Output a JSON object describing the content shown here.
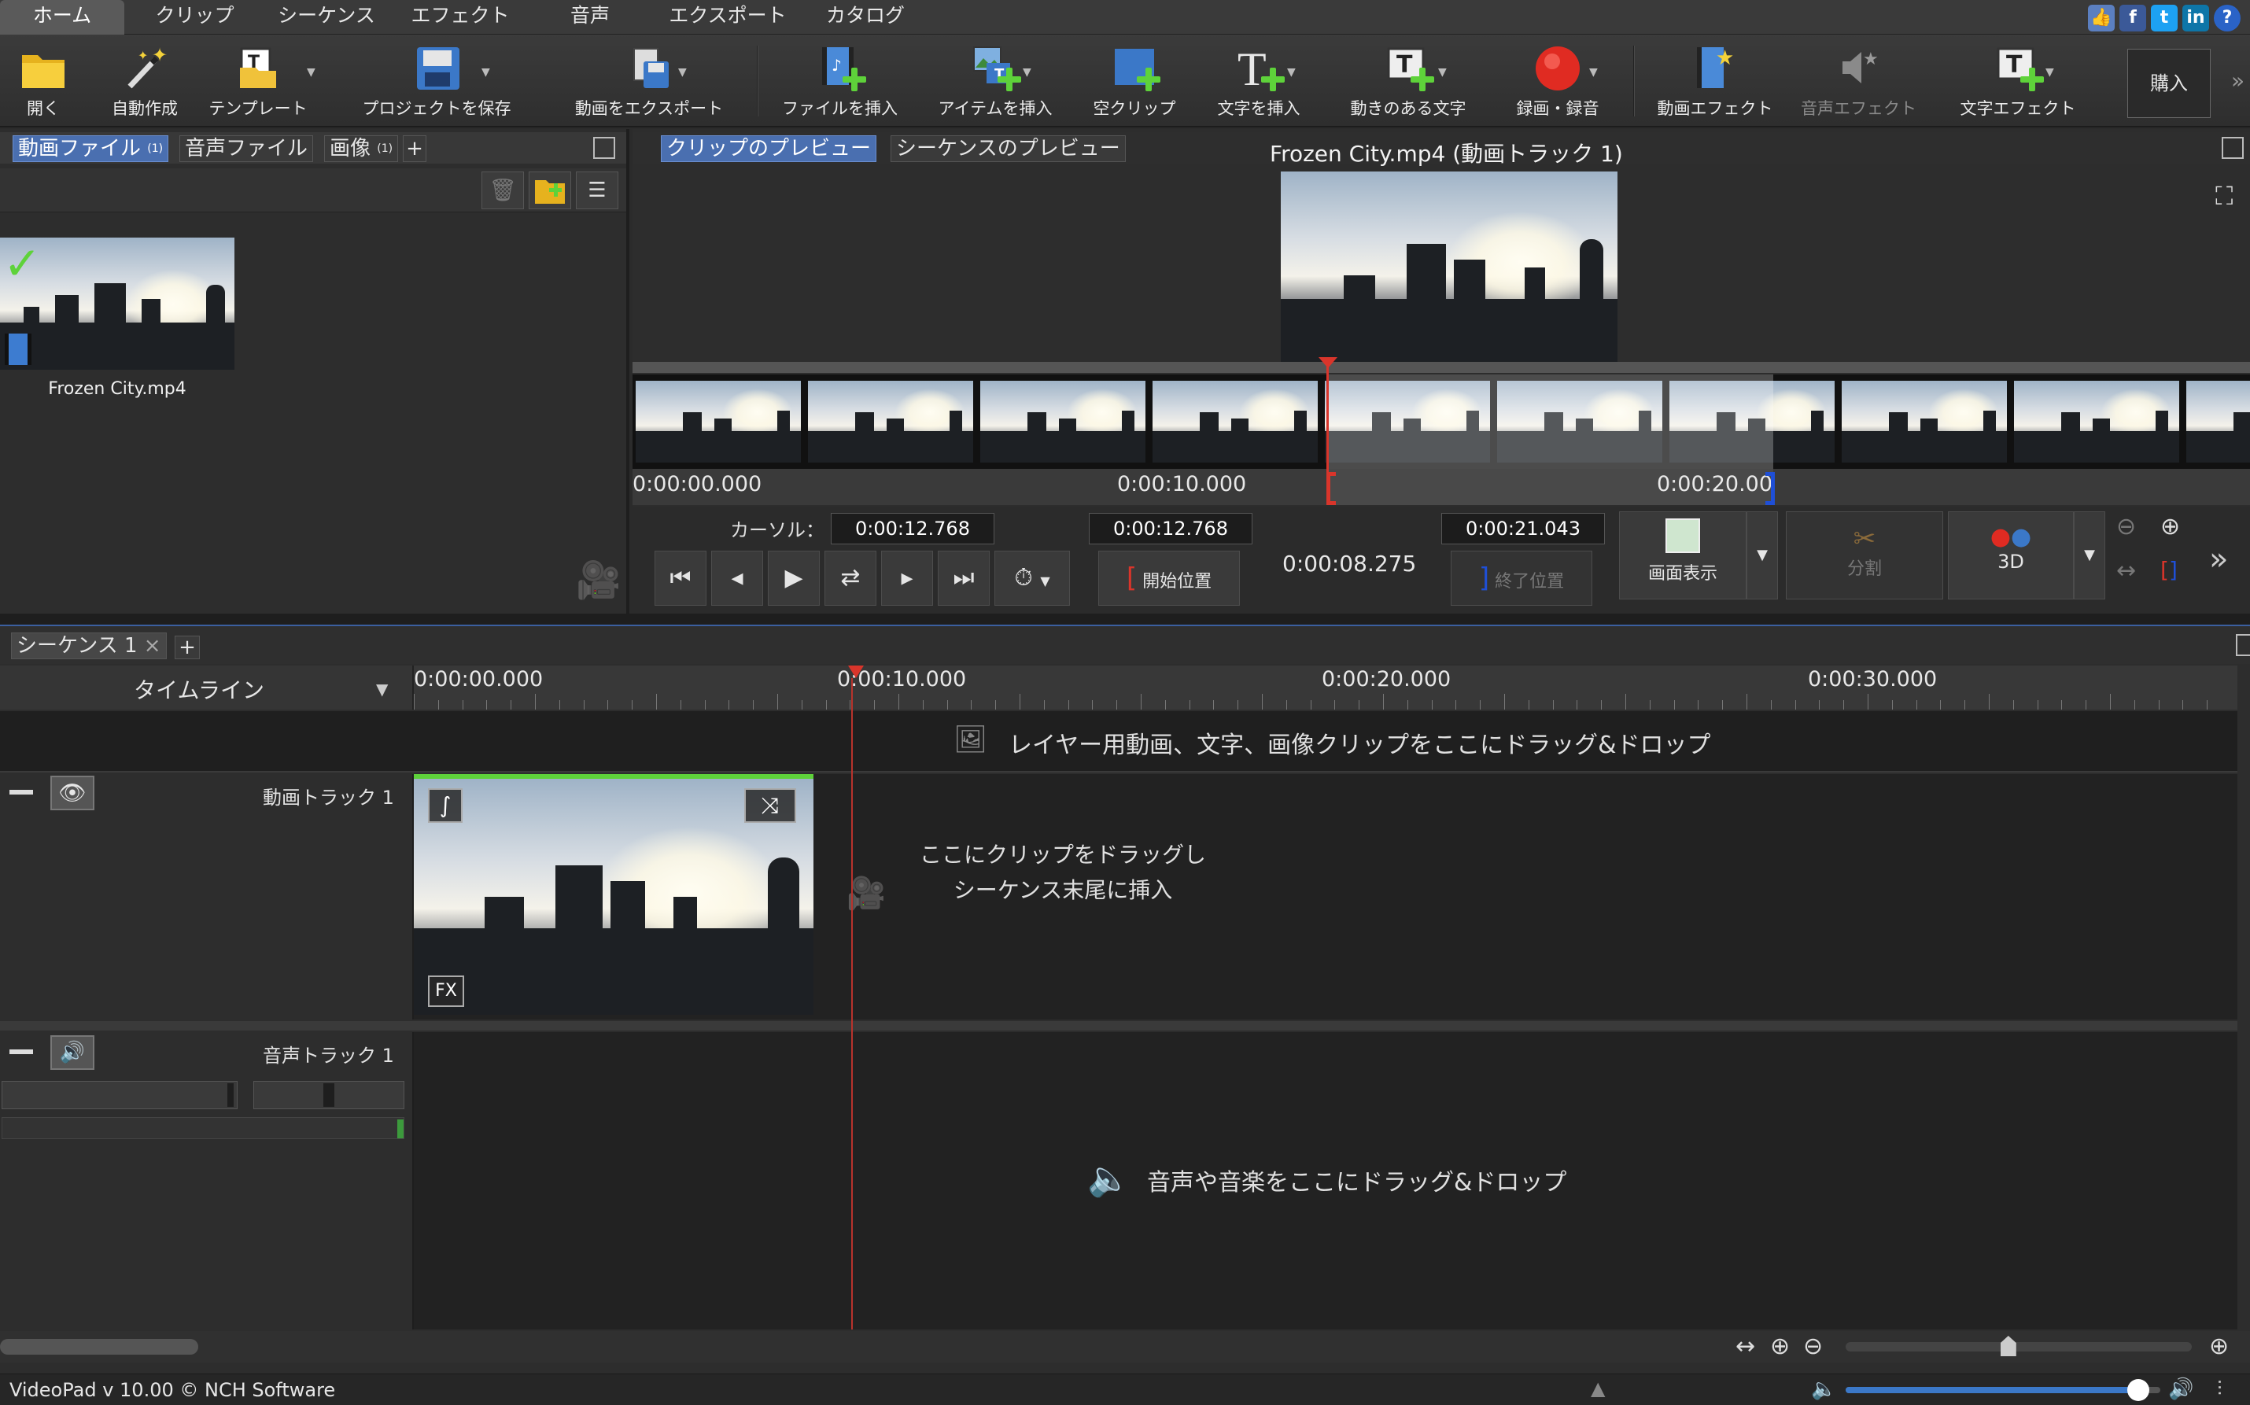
{
  "menu": {
    "tabs": [
      "ホーム",
      "クリップ",
      "シーケンス",
      "エフェクト",
      "音声",
      "エクスポート",
      "カタログ"
    ],
    "active": "ホーム"
  },
  "social": [
    "like-icon",
    "facebook-icon",
    "twitter-icon",
    "linkedin-icon",
    "help-icon"
  ],
  "toolbar": {
    "open": "開く",
    "auto": "自動作成",
    "template": "テンプレート",
    "save_project": "プロジェクトを保存",
    "export_video": "動画をエクスポート",
    "insert_file": "ファイルを挿入",
    "insert_item": "アイテムを挿入",
    "blank_clip": "空クリップ",
    "insert_text": "文字を挿入",
    "animated_text": "動きのある文字",
    "record": "録画・録音",
    "video_effects": "動画エフェクト",
    "audio_effects": "音声エフェクト",
    "text_effects": "文字エフェクト",
    "buy": "購入"
  },
  "bin": {
    "tabs": [
      {
        "label": "動画ファイル",
        "count": "(1)"
      },
      {
        "label": "音声ファイル",
        "count": ""
      },
      {
        "label": "画像",
        "count": "(1)"
      }
    ],
    "add_tab": "+",
    "file_name": "Frozen City.mp4"
  },
  "preview": {
    "tabs": [
      "クリップのプレビュー",
      "シーケンスのプレビュー"
    ],
    "title": "Frozen City.mp4 (動画トラック 1)",
    "ruler": [
      "0:00:00.000",
      "0:00:10.000",
      "0:00:20.00"
    ],
    "cursor_label": "カーソル：",
    "cursor_time": "0:00:12.768",
    "start_time": "0:00:12.768",
    "duration": "0:00:08.275",
    "end_time": "0:00:21.043",
    "start_label": "開始位置",
    "end_label": "終了位置",
    "screen_label": "画面表示",
    "split_label": "分割",
    "three_d_label": "3D"
  },
  "sequence": {
    "tab": "シーケンス 1",
    "add_tab": "+",
    "view_mode": "タイムライン",
    "ruler": [
      "0:00:00.000",
      "0:00:10.000",
      "0:00:20.000",
      "0:00:30.000"
    ],
    "overlay_hint": "レイヤー用動画、文字、画像クリップをここにドラッグ&ドロップ",
    "video_track": "動画トラック 1",
    "drop_hint": "ここにクリップをドラッグしシーケンス末尾に挿入",
    "audio_track": "音声トラック 1",
    "audio_hint": "音声や音楽をここにドラッグ&ドロップ",
    "fx": "FX"
  },
  "status": {
    "text": "VideoPad v 10.00 © NCH Software",
    "volume_level": 0.93,
    "zoom_level": 0.47
  },
  "colors": {
    "accent": "#4a6fb0",
    "playhead": "#d9352b",
    "end_marker": "#1f4fd6",
    "green": "#5ed23a"
  }
}
